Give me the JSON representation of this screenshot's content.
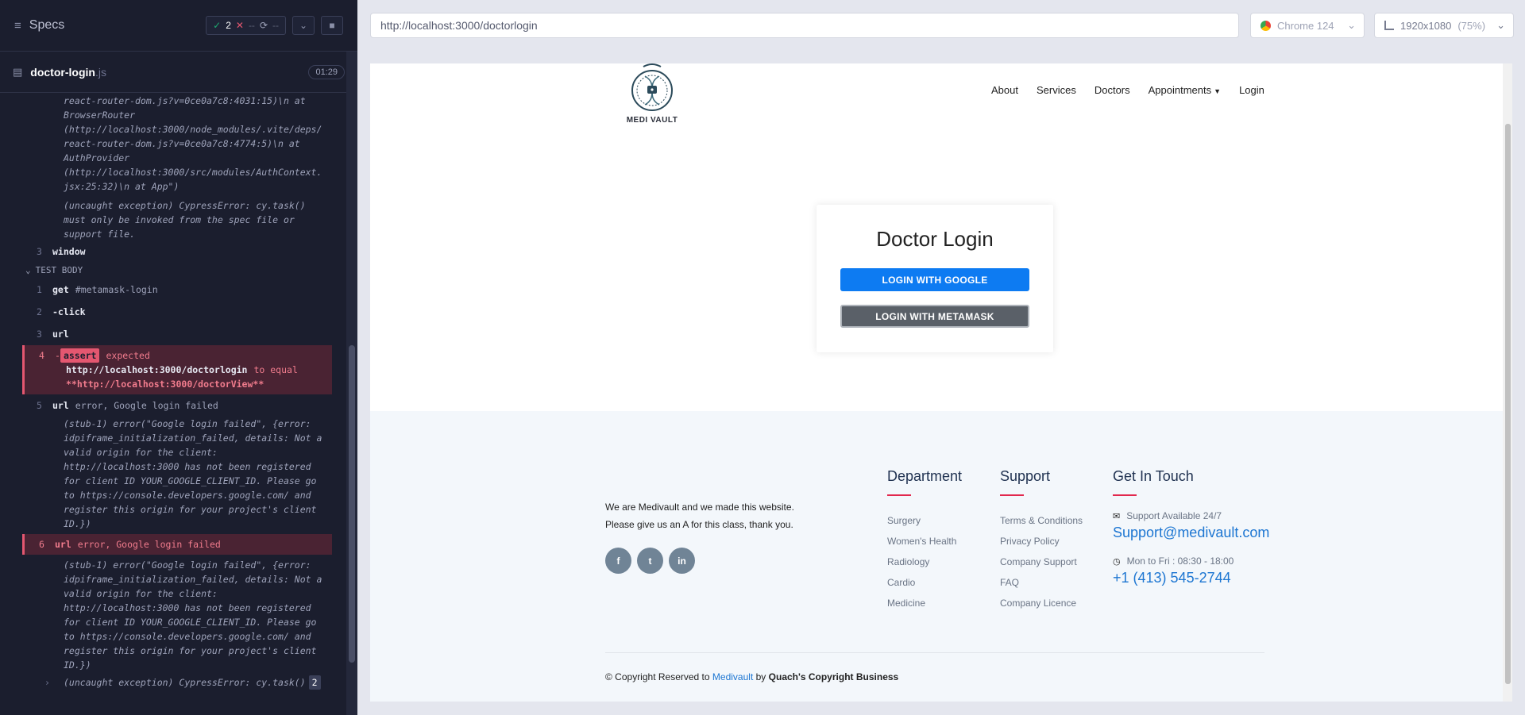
{
  "runner": {
    "specs_label": "Specs",
    "passed_count": "2",
    "failed_count": "--",
    "pending_count": "--",
    "spec_name": "doctor-login",
    "spec_ext": ".js",
    "duration": "01:29"
  },
  "log": {
    "pre_lines": [
      "react-router-dom.js?v=0ce0a7c8:4031:15)\\n at",
      "BrowserRouter",
      "(http://localhost:3000/node_modules/.vite/deps/",
      "react-router-dom.js?v=0ce0a7c8:4774:5)\\n at",
      "AuthProvider",
      "(http://localhost:3000/src/modules/AuthContext.",
      "jsx:25:32)\\n at App\")"
    ],
    "pre_exception": [
      "(uncaught exception)  CypressError: cy.task()",
      "must only be invoked from the spec file or",
      "support file."
    ],
    "window_num": "3",
    "window_cmd": "window",
    "section_label": "TEST BODY",
    "cmd1_num": "1",
    "cmd1": "get",
    "cmd1_arg": "#metamask-login",
    "cmd2_num": "2",
    "cmd2": "-click",
    "cmd3_num": "3",
    "cmd3": "url",
    "cmd4_num": "4",
    "cmd4_prefix": "-",
    "cmd4_badge": "assert",
    "cmd4_expected": "expected",
    "cmd4_url": "http://localhost:3000/doctorlogin",
    "cmd4_to_equal": "to equal",
    "cmd4_target": "**http://localhost:3000/doctorView**",
    "cmd5_num": "5",
    "cmd5": "url",
    "cmd5_arg": "error, Google login failed",
    "stub_lines": [
      "(stub-1)  error(\"Google login failed\", {error:",
      "idpiframe_initialization_failed, details: Not a",
      "valid origin for the client:",
      "http://localhost:3000 has not been registered",
      "for client ID YOUR_GOOGLE_CLIENT_ID. Please go",
      "to https://console.developers.google.com/ and",
      "register this origin for your project's client",
      "ID.})"
    ],
    "cmd6_num": "6",
    "cmd6": "url",
    "cmd6_arg": "error, Google login failed",
    "last_exception": "(uncaught exception)  CypressError: cy.task()",
    "last_badge": "2"
  },
  "browser": {
    "url": "http://localhost:3000/doctorlogin",
    "browser_name": "Chrome 124",
    "viewport": "1920x1080",
    "zoom": "(75%)"
  },
  "site": {
    "brand": "MEDI VAULT",
    "nav": [
      "About",
      "Services",
      "Doctors",
      "Appointments",
      "Login"
    ],
    "login_title": "Doctor Login",
    "google_btn": "LOGIN WITH GOOGLE",
    "metamask_btn": "LOGIN WITH METAMASK",
    "about_line1": "We are Medivault and we made this website.",
    "about_line2": "Please give us an A for this class, thank you.",
    "department_title": "Department",
    "department_items": [
      "Surgery",
      "Women's Health",
      "Radiology",
      "Cardio",
      "Medicine"
    ],
    "support_title": "Support",
    "support_items": [
      "Terms & Conditions",
      "Privacy Policy",
      "Company Support",
      "FAQ",
      "Company Licence"
    ],
    "contact_title": "Get In Touch",
    "contact_support_label": "Support Available 24/7",
    "contact_email": "Support@medivault.com",
    "contact_hours_label": "Mon to Fri : 08:30 - 18:00",
    "contact_phone": "+1 (413) 545-2744",
    "copyright_prefix": "© Copyright Reserved to",
    "copyright_link": "Medivault",
    "copyright_by": "by",
    "copyright_owner": "Quach's Copyright Business"
  },
  "colors": {
    "accent_blue": "#0d7bf2",
    "error_red": "#e45770",
    "footer_accent": "#e2284d"
  }
}
